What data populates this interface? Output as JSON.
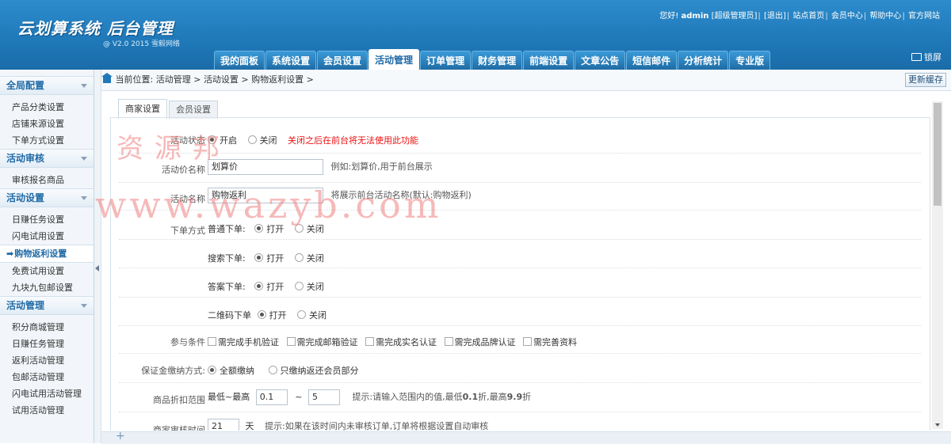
{
  "header": {
    "logo_title": "云划算系统 后台管理",
    "logo_sub": "@ V2.0 2015 雪毅网络",
    "greeting": "您好!",
    "username": "admin",
    "role": "[超级管理员]",
    "logout": "[退出]",
    "links": [
      "站点首页",
      "会员中心",
      "帮助中心",
      "官方网站"
    ],
    "lock_label": "锁屏"
  },
  "nav": {
    "tabs": [
      "我的面板",
      "系统设置",
      "会员设置",
      "活动管理",
      "订单管理",
      "财务管理",
      "前端设置",
      "文章公告",
      "短信邮件",
      "分析统计",
      "专业版"
    ],
    "active_index": 3
  },
  "sidebar": {
    "groups": [
      {
        "title": "全局配置",
        "items": [
          "产品分类设置",
          "店铺来源设置",
          "下单方式设置"
        ]
      },
      {
        "title": "活动审核",
        "items": [
          "审核报名商品"
        ]
      },
      {
        "title": "活动设置",
        "items": [
          "日赚任务设置",
          "闪电试用设置",
          "购物返利设置",
          "免费试用设置",
          "九块九包邮设置"
        ]
      },
      {
        "title": "活动管理",
        "items": [
          "积分商城管理",
          "日赚任务管理",
          "返利活动管理",
          "包邮活动管理",
          "闪电试用活动管理",
          "试用活动管理"
        ]
      }
    ],
    "active_item": "购物返利设置"
  },
  "breadcrumb": {
    "prefix": "当前位置:",
    "path": [
      "活动管理",
      "活动设置",
      "购物返利设置"
    ],
    "refresh_label": "更新缓存"
  },
  "tabs": [
    "商家设置",
    "会员设置"
  ],
  "form": {
    "status": {
      "label": "活动状态",
      "on": "开启",
      "off": "关闭",
      "selected": "on",
      "warning": "关闭之后在前台将无法使用此功能"
    },
    "price_name": {
      "label": "活动价名称",
      "value": "划算价",
      "hint": "例如:划算价,用于前台展示"
    },
    "activity_name": {
      "label": "活动名称",
      "value": "购物返利",
      "hint": "将展示前台活动名称(默认:购物返利)"
    },
    "order_mode": {
      "label": "下单方式",
      "options": [
        {
          "name": "普通下单:",
          "selected": "open"
        },
        {
          "name": "搜索下单:",
          "selected": "open"
        },
        {
          "name": "答案下单:",
          "selected": "open"
        },
        {
          "name": "二维码下单",
          "selected": "open"
        }
      ],
      "open_label": "打开",
      "close_label": "关闭"
    },
    "conditions": {
      "label": "参与条件",
      "items": [
        "需完成手机验证",
        "需完成邮箱验证",
        "需完成实名认证",
        "需完成品牌认证",
        "需完善资料"
      ]
    },
    "deposit": {
      "label": "保证金缴纳方式:",
      "options": [
        "全额缴纳",
        "只缴纳返还会员部分"
      ],
      "selected_index": 0
    },
    "discount": {
      "label": "商品折扣范围",
      "prefix": "最低~最高",
      "min": "0.1",
      "sep": "~",
      "max": "5",
      "hint_pre": "提示:请输入范围内的值,最低",
      "hint_min": "0.1",
      "hint_mid": "折,最高",
      "hint_max": "9.9",
      "hint_post": "折"
    },
    "review_time": {
      "label": "商家审核时间",
      "value": "21",
      "unit": "天",
      "hint": "提示:如果在该时间内未审核订单,订单将根据设置自动审核"
    }
  },
  "watermark": {
    "line1": "资源邦",
    "line2": "www.wazyb.com"
  }
}
